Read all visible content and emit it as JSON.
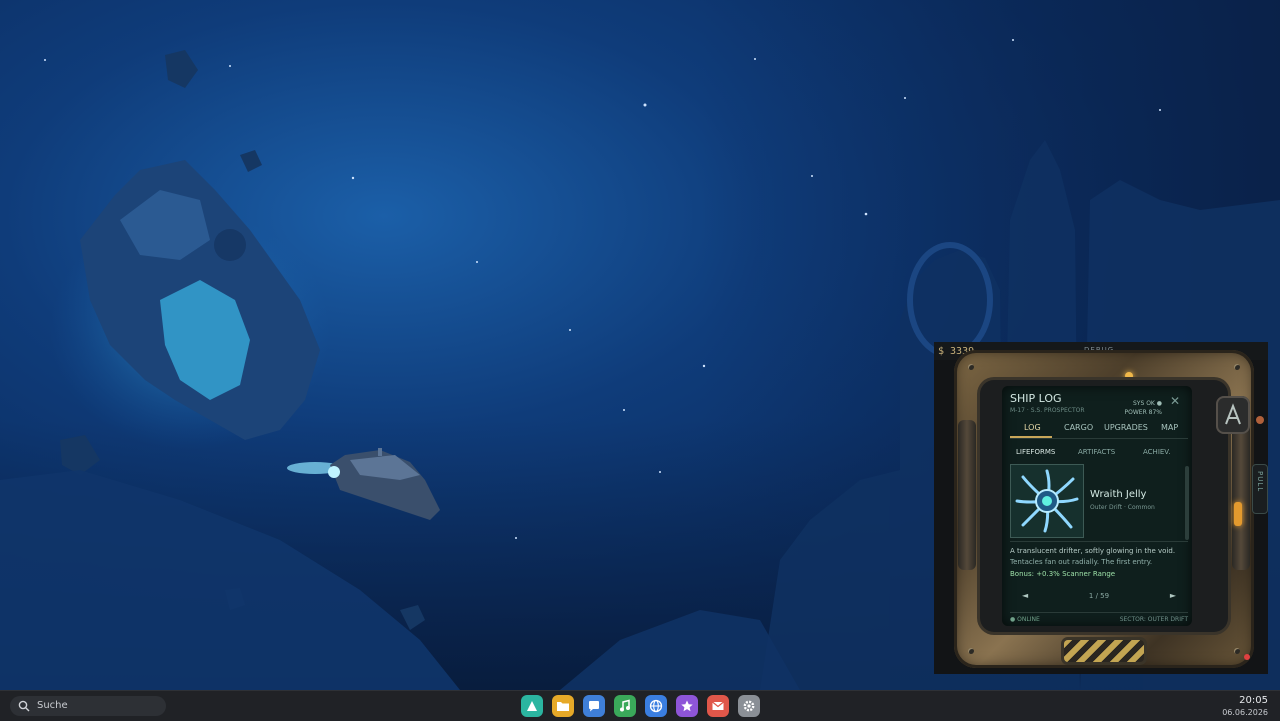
{
  "widget": {
    "money": "$ 3339",
    "debug_label": "DEBUG",
    "pull_label": "PULL",
    "screen": {
      "title": "SHIP LOG",
      "subtitle": "M-17 · S.S. PROSPECTOR",
      "sys_status": "SYS OK ●",
      "power": "POWER 87%",
      "close_glyph": "✕",
      "tabs": [
        {
          "label": "LOG",
          "active": true
        },
        {
          "label": "CARGO",
          "active": false
        },
        {
          "label": "UPGRADES",
          "active": false
        },
        {
          "label": "MAP",
          "active": false
        }
      ],
      "subtabs": [
        {
          "label": "LIFEFORMS",
          "active": true
        },
        {
          "label": "ARTIFACTS",
          "active": false
        },
        {
          "label": "ACHIEV.",
          "active": false
        }
      ],
      "entry": {
        "name": "Wraith Jelly",
        "meta": "Outer Drift · Common",
        "desc_line1": "A translucent drifter, softly glowing in the void.",
        "desc_line2": "Tentacles fan out radially. The first entry.",
        "bonus": "Bonus: +0.3% Scanner Range"
      },
      "pager": {
        "prev": "◄",
        "next": "►",
        "count": "1 / 59"
      },
      "status_left": "● ONLINE",
      "status_right": "SECTOR: OUTER DRIFT"
    }
  },
  "taskbar": {
    "search_placeholder": "Suche",
    "dock": [
      {
        "icon": "triangle-app-icon",
        "color": "#2bb5a0"
      },
      {
        "icon": "folder-icon",
        "color": "#e6a928"
      },
      {
        "icon": "chat-icon",
        "color": "#3f7fd8"
      },
      {
        "icon": "music-icon",
        "color": "#3aa95a"
      },
      {
        "icon": "globe-icon",
        "color": "#3a7ee0"
      },
      {
        "icon": "star-icon",
        "color": "#8e55d8"
      },
      {
        "icon": "mail-icon",
        "color": "#e0574a"
      },
      {
        "icon": "gear-icon",
        "color": "#8a8f96"
      }
    ],
    "clock_time": "20:05",
    "clock_date": "06.06.2026"
  }
}
